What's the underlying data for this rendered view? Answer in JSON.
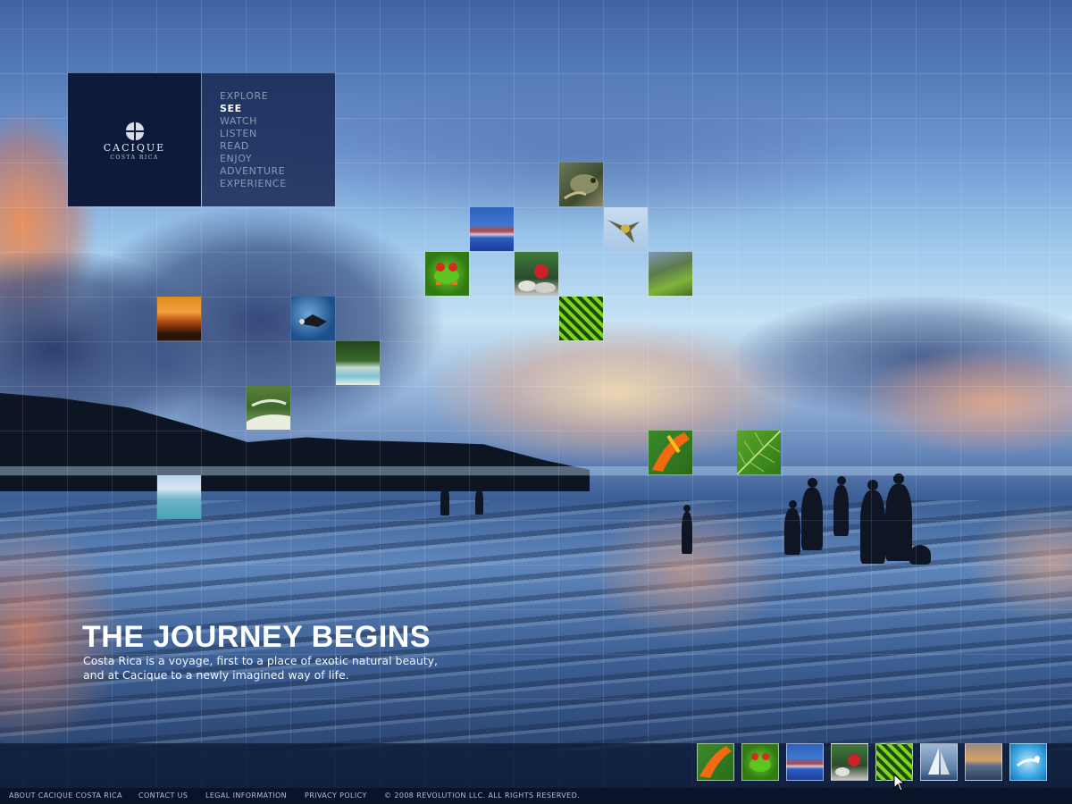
{
  "brand": {
    "name": "CACIQUE",
    "sub": "COSTA RICA"
  },
  "nav": [
    {
      "label": "EXPLORE",
      "active": false
    },
    {
      "label": "SEE",
      "active": true
    },
    {
      "label": "WATCH",
      "active": false
    },
    {
      "label": "LISTEN",
      "active": false
    },
    {
      "label": "READ",
      "active": false
    },
    {
      "label": "ENJOY",
      "active": false
    },
    {
      "label": "ADVENTURE",
      "active": false
    },
    {
      "label": "EXPERIENCE",
      "active": false
    }
  ],
  "hero": {
    "title": "THE JOURNEY BEGINS",
    "text": "Costa Rica is a voyage, first to a place of exotic natural beauty, and at Cacique to a newly imagined way of life."
  },
  "tiles": [
    {
      "icon": "iguana-photo-icon"
    },
    {
      "icon": "pool-photo-icon"
    },
    {
      "icon": "bird-photo-icon"
    },
    {
      "icon": "tree-frog-photo-icon"
    },
    {
      "icon": "flower-stones-photo-icon"
    },
    {
      "icon": "coast-photo-icon"
    },
    {
      "icon": "fern-photo-icon"
    },
    {
      "icon": "sunset-photo-icon"
    },
    {
      "icon": "diver-photo-icon"
    },
    {
      "icon": "beach-cove-photo-icon"
    },
    {
      "icon": "golf-course-photo-icon"
    },
    {
      "icon": "heliconia-flower-photo-icon"
    },
    {
      "icon": "leaf-photo-icon"
    },
    {
      "icon": "sea-horizon-photo-icon"
    }
  ],
  "thumbnails": [
    {
      "icon": "heliconia-thumb-icon"
    },
    {
      "icon": "tree-frog-thumb-icon"
    },
    {
      "icon": "pool-thumb-icon"
    },
    {
      "icon": "flower-stones-thumb-icon"
    },
    {
      "icon": "fern-thumb-icon"
    },
    {
      "icon": "sailboat-thumb-icon"
    },
    {
      "icon": "sea-sunset-thumb-icon"
    },
    {
      "icon": "swimmer-thumb-icon"
    }
  ],
  "footer": {
    "about": "ABOUT CACIQUE COSTA RICA",
    "contact": "CONTACT US",
    "legal": "LEGAL INFORMATION",
    "privacy": "PRIVACY POLICY",
    "copyright": "© 2008 REVOLUTION LLC. ALL RIGHTS RESERVED."
  }
}
